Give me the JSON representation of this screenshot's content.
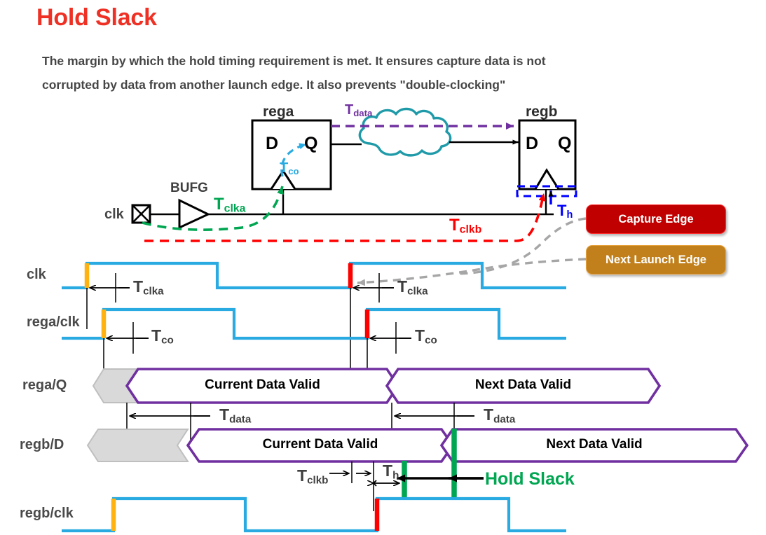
{
  "page": {
    "title": "Hold Slack",
    "subtitle_line1": "The margin by which the hold timing requirement is met. It ensures  capture data is not",
    "subtitle_line2": "corrupted by data from another launch edge. It  also prevents \"double-clocking\""
  },
  "colors": {
    "title_red": "#ee3124",
    "text_gray": "#464646",
    "clock_blue": "#29abe2",
    "data_purple": "#7030a0",
    "cloud_teal": "#1f9aa8",
    "green": "#00a651",
    "orange_edge": "#ffb310",
    "red_edge": "#ff0000",
    "capture_badge": "#c00000",
    "launch_badge": "#c1801c",
    "blue_dashed": "#0000ff",
    "gray_callout": "#a6a6a6",
    "hex_gray_fill": "#d9d9d9"
  },
  "circuit": {
    "clk_port_label": "clk",
    "bufg_label": "BUFG",
    "rega_label": "rega",
    "regb_label": "regb",
    "rega_d": "D",
    "rega_q": "Q",
    "regb_d": "D",
    "regb_q": "Q",
    "t_clka": {
      "base": "T",
      "sub": "clka"
    },
    "t_co": {
      "base": "T",
      "sub": "co"
    },
    "t_data": {
      "base": "T",
      "sub": "data"
    },
    "t_clkb": {
      "base": "T",
      "sub": "clkb"
    },
    "t_h": {
      "base": "T",
      "sub": "h"
    }
  },
  "callouts": {
    "capture_edge": "Capture Edge",
    "next_launch_edge": "Next Launch Edge"
  },
  "waveforms": {
    "rows": [
      {
        "name": "clk",
        "label": "clk"
      },
      {
        "name": "rega-clk",
        "label": "rega/clk"
      },
      {
        "name": "rega-q",
        "label": "rega/Q"
      },
      {
        "name": "regb-d",
        "label": "regb/D"
      },
      {
        "name": "regb-clk",
        "label": "regb/clk"
      }
    ],
    "data_values": {
      "rega_q_current": "Current Data Valid",
      "rega_q_next": "Next Data Valid",
      "regb_d_current": "Current Data Valid",
      "regb_d_next": "Next Data Valid"
    },
    "annotations": {
      "t_clka_1": {
        "base": "T",
        "sub": "clka"
      },
      "t_clka_2": {
        "base": "T",
        "sub": "clka"
      },
      "t_co_1": {
        "base": "T",
        "sub": "co"
      },
      "t_co_2": {
        "base": "T",
        "sub": "co"
      },
      "t_data_1": {
        "base": "T",
        "sub": "data"
      },
      "t_data_2": {
        "base": "T",
        "sub": "data"
      },
      "t_clkb": {
        "base": "T",
        "sub": "clkb"
      },
      "t_h": {
        "base": "T",
        "sub": "h"
      },
      "hold_slack": "Hold Slack"
    }
  }
}
